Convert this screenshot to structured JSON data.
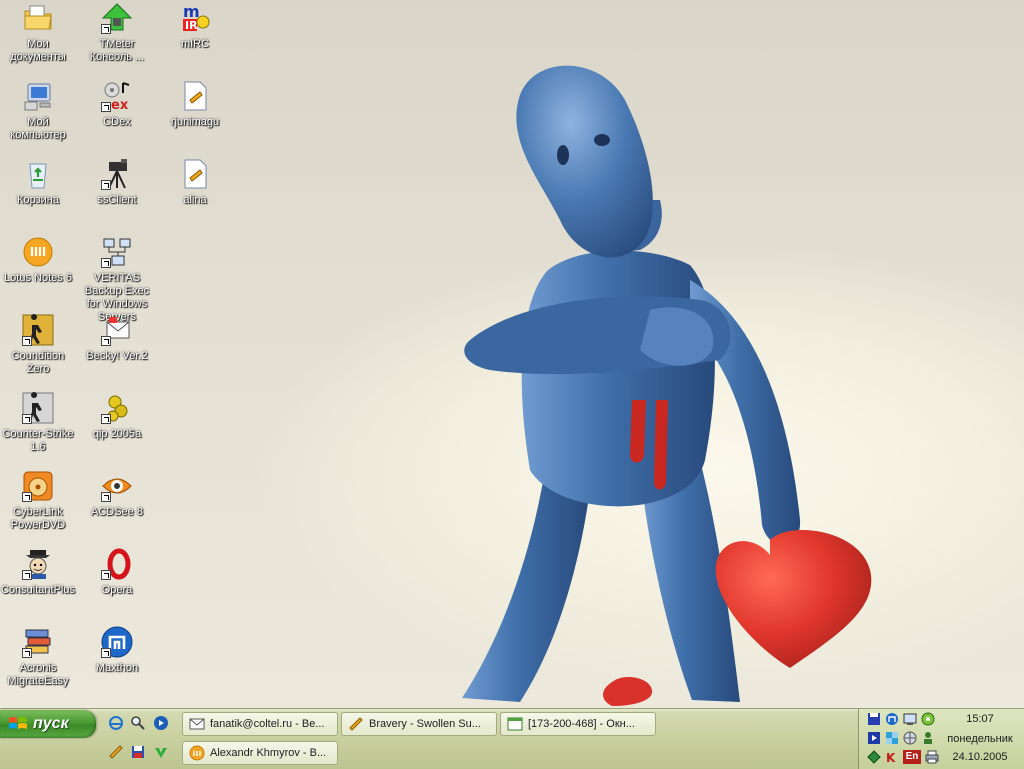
{
  "desktop": {
    "icons": [
      {
        "label": "Мои документы",
        "icon": "my-documents-folder-icon"
      },
      {
        "label": "Мой компьютер",
        "icon": "my-computer-icon"
      },
      {
        "label": "Корзина",
        "icon": "recycle-bin-icon"
      },
      {
        "label": "Lotus Notes 6",
        "icon": "lotus-notes-icon"
      },
      {
        "label": "Coundition Zero",
        "icon": "counter-strike-cz-icon"
      },
      {
        "label": "Counter-Strike 1.6",
        "icon": "counter-strike-icon"
      },
      {
        "label": "CyberLink PowerDVD",
        "icon": "powerdvd-icon"
      },
      {
        "label": "ConsultantPlus",
        "icon": "consultantplus-icon"
      },
      {
        "label": "Acronis MigrateEasy",
        "icon": "acronis-icon"
      },
      {
        "label": "TMeter Консоль ...",
        "icon": "tmeter-icon"
      },
      {
        "label": "CDex",
        "icon": "cdex-icon"
      },
      {
        "label": "ssClient",
        "icon": "ssclient-camera-icon"
      },
      {
        "label": "VERITAS Backup Exec for Windows Servers",
        "icon": "veritas-backup-icon"
      },
      {
        "label": "Becky! Ver.2",
        "icon": "becky-mail-icon"
      },
      {
        "label": "qip 2005a",
        "icon": "qip-icon"
      },
      {
        "label": "ACDSee 8",
        "icon": "acdsee-icon"
      },
      {
        "label": "Opera",
        "icon": "opera-icon"
      },
      {
        "label": "Maxthon",
        "icon": "maxthon-icon"
      },
      {
        "label": "mIRC",
        "icon": "mirc-icon"
      },
      {
        "label": "rjunimagu",
        "icon": "winamp-file-icon"
      },
      {
        "label": "alina",
        "icon": "winamp-file-icon"
      }
    ]
  },
  "taskbar": {
    "start_label": "пуск",
    "quick_launch": [
      {
        "icon": "internet-explorer-icon"
      },
      {
        "icon": "search-icon"
      },
      {
        "icon": "media-player-icon"
      },
      {
        "icon": "winamp-icon"
      },
      {
        "icon": "save-disk-icon"
      },
      {
        "icon": "checkmark-icon"
      }
    ],
    "tasks": [
      {
        "title": "fanatik@coltel.ru - Be...",
        "icon": "mail-icon"
      },
      {
        "title": "Bravery - Swollen Su...",
        "icon": "winamp-icon"
      },
      {
        "title": "[173-200-468] - Окн...",
        "icon": "qip-window-icon"
      },
      {
        "title": "Alexandr Khmyrov - B...",
        "icon": "lotus-notes-icon"
      }
    ],
    "tray": {
      "language": "En",
      "time": "15:07",
      "day": "понедельник",
      "date": "24.10.2005"
    }
  },
  "colors": {
    "taskbar": "#c9d09f",
    "start_button": "#4a9a34",
    "figure_blue": "#3f6ea8",
    "heart_red": "#d9322b"
  }
}
